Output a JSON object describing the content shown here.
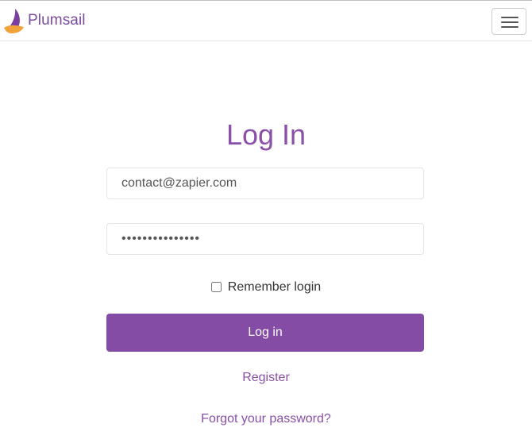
{
  "header": {
    "brand_name": "Plumsail",
    "logo_icon": "sailboat-logo-icon",
    "menu_icon": "hamburger-menu-icon"
  },
  "login_form": {
    "title": "Log In",
    "email_value": "contact@zapier.com",
    "password_value": "•••••••••••••••",
    "remember_label": "Remember login",
    "remember_checked": false,
    "submit_label": "Log in"
  },
  "links": {
    "register": "Register",
    "forgot_password": "Forgot your password?"
  },
  "colors": {
    "accent": "#854ca5",
    "link": "#8a4fa8",
    "logo_purple": "#7b3fa0",
    "logo_orange": "#f0a23b"
  }
}
